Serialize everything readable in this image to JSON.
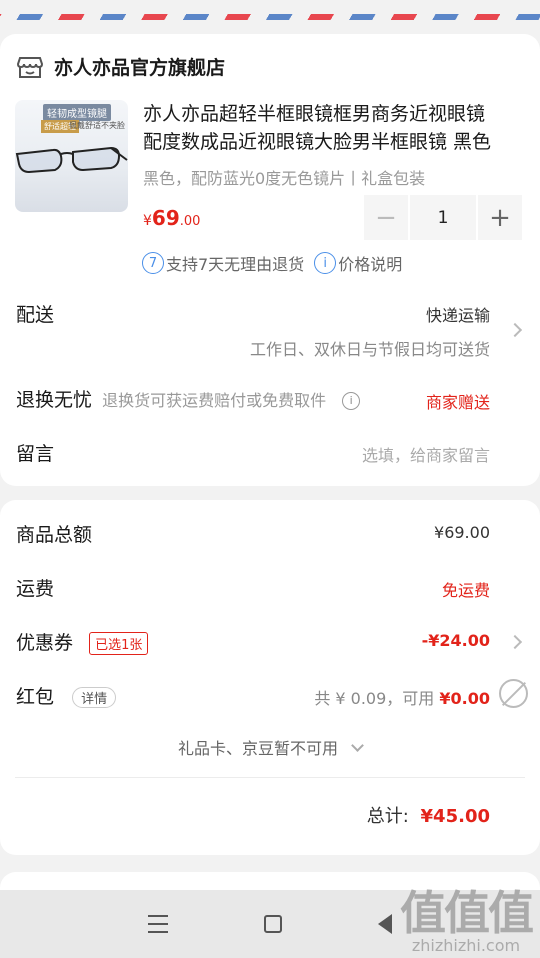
{
  "colors": {
    "accent": "#e2231a",
    "info": "#4a8fe8",
    "muted": "#999999"
  },
  "shop": {
    "name": "亦人亦品官方旗舰店",
    "icon": "store-icon"
  },
  "product": {
    "image_text_1": "轻韧成型镜腿",
    "image_text_2": "舒适超轻",
    "image_text_3": "佩戴舒适不夹脸",
    "title_line1": "亦人亦品超轻半框眼镜框男商务近视眼镜",
    "title_line2": "配度数成品近视眼镜大脸男半框眼镜 黑色",
    "spec": "黑色，配防蓝光0度无色镜片丨礼盒包装",
    "price_currency": "¥",
    "price_int": "69",
    "price_dec": ".00",
    "quantity": "1",
    "minus": "−",
    "plus": "+",
    "tag1_icon_text": "7",
    "tag1": "支持7天无理由退货",
    "tag2_icon_text": "i",
    "tag2": "价格说明"
  },
  "delivery": {
    "label": "配送",
    "method": "快递运输",
    "note": "工作日、双休日与节假日均可送货"
  },
  "return": {
    "label": "退换无忧",
    "desc": "退换货可获运费赔付或免费取件",
    "info": "i",
    "status": "商家赠送"
  },
  "message": {
    "label": "留言",
    "placeholder": "选填，给商家留言"
  },
  "summary": {
    "total_goods_label": "商品总额",
    "total_goods": "¥69.00",
    "shipping_label": "运费",
    "shipping": "免运费",
    "coupon_label": "优惠券",
    "coupon_tag": "已选1张",
    "coupon_value": "-¥24.00",
    "redpacket_label": "红包",
    "redpacket_tag": "详情",
    "redpacket_total": "共 ¥ 0.09，可用 ",
    "redpacket_usable": "¥0.00",
    "giftcard_note": "礼品卡、京豆暂不可用",
    "total_label": "总计:",
    "total": "¥45.00"
  },
  "nav": {
    "menu_icon": "menu-icon",
    "home_icon": "home-icon",
    "back_icon": "back-icon"
  },
  "watermark": {
    "big": "值值值",
    "small": "zhizhizhi.com"
  }
}
